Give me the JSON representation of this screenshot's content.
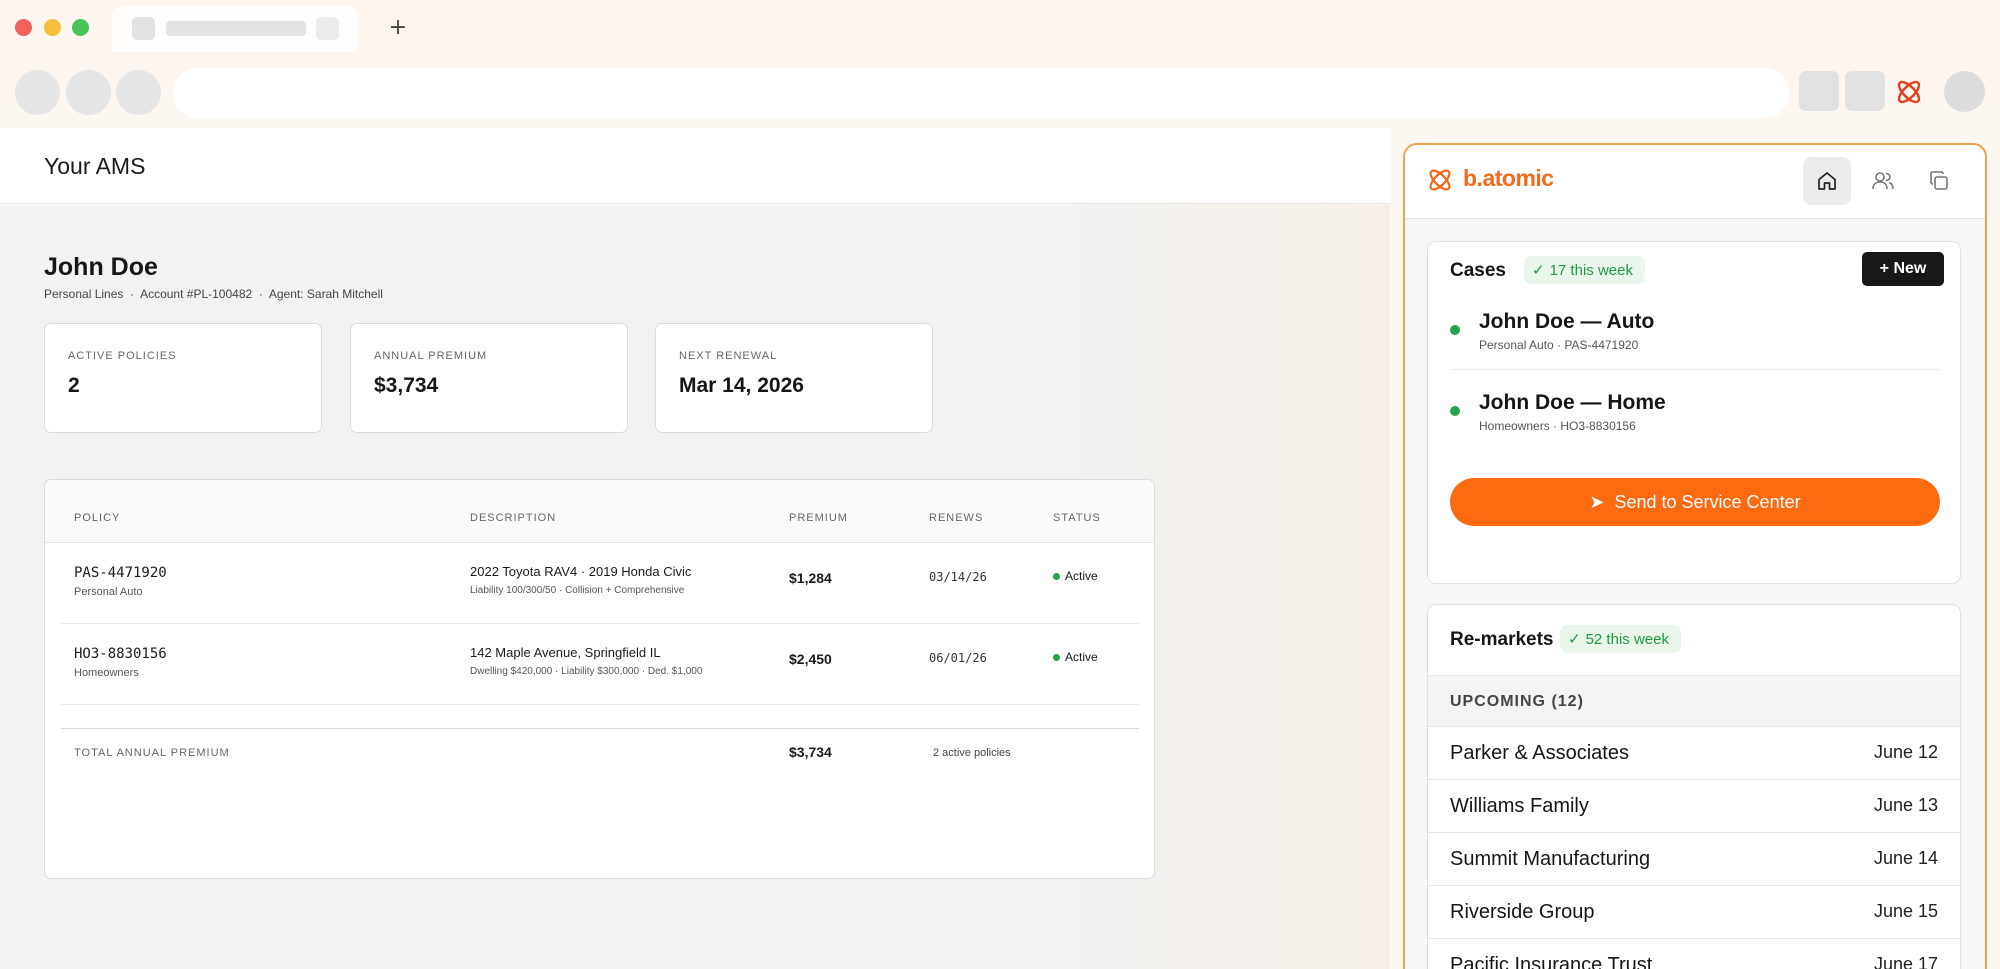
{
  "browser": {
    "new_tab_label": "+"
  },
  "ams": {
    "app_title": "Your AMS",
    "client": {
      "name": "John Doe",
      "line": "Personal Lines",
      "account": "Account #PL-100482",
      "agent": "Agent: Sarah Mitchell",
      "separator": "·"
    },
    "stats": [
      {
        "label": "ACTIVE POLICIES",
        "value": "2"
      },
      {
        "label": "ANNUAL PREMIUM",
        "value": "$3,734"
      },
      {
        "label": "NEXT RENEWAL",
        "value": "Mar 14, 2026"
      }
    ],
    "table": {
      "headers": [
        "POLICY",
        "DESCRIPTION",
        "PREMIUM",
        "RENEWS",
        "STATUS"
      ],
      "rows": [
        {
          "policy": "PAS-4471920",
          "type": "Personal Auto",
          "description": "2022 Toyota RAV4 · 2019 Honda Civic",
          "details": "Liability 100/300/50 · Collision + Comprehensive",
          "premium": "$1,284",
          "renews": "03/14/26",
          "status": "Active"
        },
        {
          "policy": "HO3-8830156",
          "type": "Homeowners",
          "description": "142 Maple Avenue, Springfield IL",
          "details": "Dwelling $420,000 · Liability $300,000 · Ded. $1,000",
          "premium": "$2,450",
          "renews": "06/01/26",
          "status": "Active"
        }
      ],
      "total_label": "TOTAL ANNUAL PREMIUM",
      "total_value": "$3,734",
      "total_count": "2 active policies"
    },
    "colors": {
      "active": "#23a34a"
    }
  },
  "panel": {
    "brand": "b.atomic",
    "brand_color": "#f26a1b",
    "nav_icons": [
      "home-icon",
      "users-icon",
      "copy-icon"
    ],
    "cases": {
      "title": "Cases",
      "badge": "17 this week",
      "new_button": "+ New",
      "items": [
        {
          "title": "John Doe — Auto",
          "type": "Personal Auto",
          "policy": "PAS-4471920"
        },
        {
          "title": "John Doe — Home",
          "type": "Homeowners",
          "policy": "HO3-8830156"
        }
      ],
      "send_button": "Send to Service Center"
    },
    "remarkets": {
      "title": "Re-markets",
      "badge": "52 this week",
      "upcoming_label": "UPCOMING (12)",
      "items": [
        {
          "name": "Parker & Associates",
          "date": "June 12"
        },
        {
          "name": "Williams Family",
          "date": "June 13"
        },
        {
          "name": "Summit Manufacturing",
          "date": "June 14"
        },
        {
          "name": "Riverside Group",
          "date": "June 15"
        },
        {
          "name": "Pacific Insurance Trust",
          "date": "June 17"
        }
      ]
    }
  }
}
